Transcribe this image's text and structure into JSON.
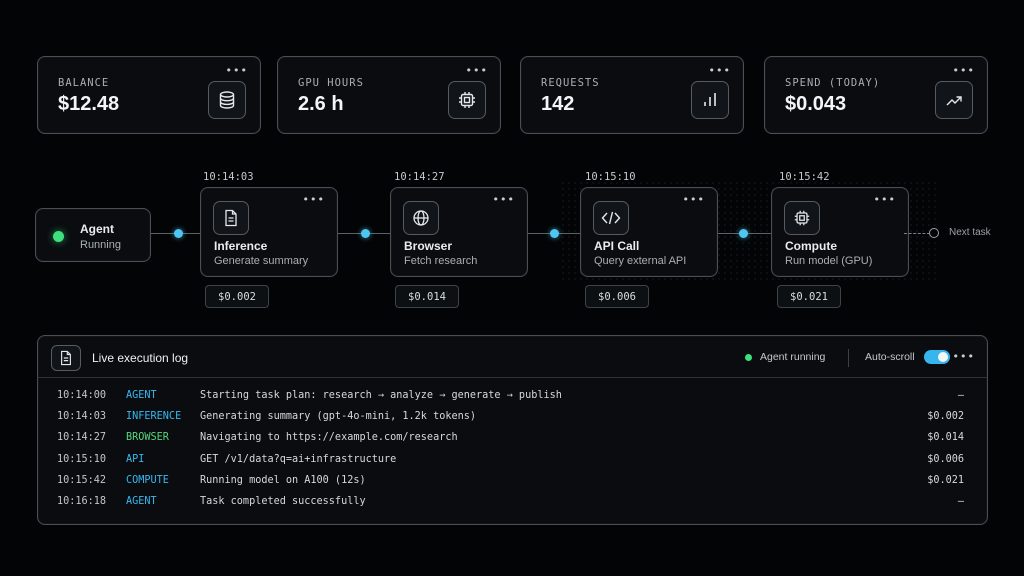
{
  "stats": [
    {
      "label": "BALANCE",
      "value": "$12.48",
      "icon": "database-icon"
    },
    {
      "label": "GPU HOURS",
      "value": "2.6 h",
      "icon": "chip-icon"
    },
    {
      "label": "REQUESTS",
      "value": "142",
      "icon": "bar-chart-icon"
    },
    {
      "label": "SPEND (TODAY)",
      "value": "$0.043",
      "icon": "trending-up-icon"
    }
  ],
  "agent": {
    "name": "Agent",
    "status": "Running"
  },
  "steps": [
    {
      "time": "10:14:03",
      "name": "Inference",
      "desc": "Generate summary",
      "cost": "$0.002",
      "icon": "document-icon"
    },
    {
      "time": "10:14:27",
      "name": "Browser",
      "desc": "Fetch research",
      "cost": "$0.014",
      "icon": "globe-icon"
    },
    {
      "time": "10:15:10",
      "name": "API Call",
      "desc": "Query external API",
      "cost": "$0.006",
      "icon": "code-icon"
    },
    {
      "time": "10:15:42",
      "name": "Compute",
      "desc": "Run model (GPU)",
      "cost": "$0.021",
      "icon": "chip-icon"
    }
  ],
  "next_task": "Next task",
  "log": {
    "title": "Live execution log",
    "status": "Agent running",
    "autoscroll_label": "Auto-scroll",
    "autoscroll_on": true,
    "rows": [
      {
        "time": "10:14:00",
        "source": "AGENT",
        "message": "Starting task plan: research → analyze → generate → publish",
        "cost": "–"
      },
      {
        "time": "10:14:03",
        "source": "INFERENCE",
        "message": "Generating summary (gpt-4o-mini, 1.2k tokens)",
        "cost": "$0.002"
      },
      {
        "time": "10:14:27",
        "source": "BROWSER",
        "message": "Navigating to https://example.com/research",
        "cost": "$0.014"
      },
      {
        "time": "10:15:10",
        "source": "API",
        "message": "GET /v1/data?q=ai+infrastructure",
        "cost": "$0.006"
      },
      {
        "time": "10:15:42",
        "source": "COMPUTE",
        "message": "Running model on A100 (12s)",
        "cost": "$0.021"
      },
      {
        "time": "10:16:18",
        "source": "AGENT",
        "message": "Task completed successfully",
        "cost": "–"
      }
    ]
  },
  "colors": {
    "accent": "#4fc6f2",
    "running": "#3ee07e",
    "inference": "#55d77e"
  }
}
